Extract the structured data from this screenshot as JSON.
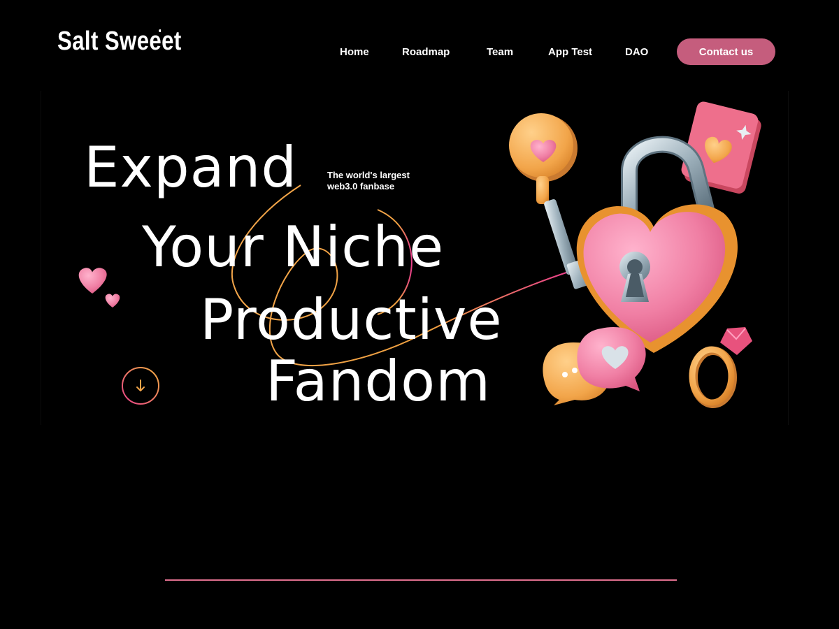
{
  "brand": {
    "logo_text": "Salt Sweeet"
  },
  "nav": {
    "items": [
      {
        "label": "Home"
      },
      {
        "label": "Roadmap"
      },
      {
        "label": "Team"
      },
      {
        "label": "App Test"
      },
      {
        "label": "DAO"
      }
    ],
    "contact_label": "Contact us"
  },
  "hero": {
    "line1": "Expand",
    "line2": "Your Niche",
    "line3": "Productive",
    "line4": "Fandom",
    "tagline": "The world's largest web3.0 fanbase"
  },
  "icons": {
    "scroll": "arrow-down-icon",
    "illustration": "heart-padlock-key-illustration"
  },
  "colors": {
    "background": "#000000",
    "accent_pink": "#c55d7d",
    "heart_pink": "#f07fa4",
    "gold": "#f2a54a",
    "divider": "#e0708f"
  }
}
